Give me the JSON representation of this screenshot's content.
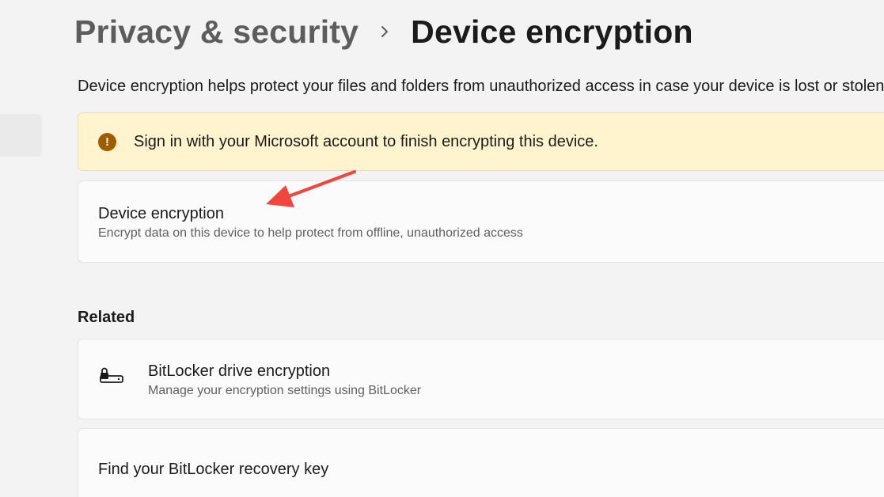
{
  "breadcrumb": {
    "parent": "Privacy & security",
    "separator_icon": "chevron-right-icon",
    "current": "Device encryption"
  },
  "description": "Device encryption helps protect your files and folders from unauthorized access in case your device is lost or stolen.",
  "warning": {
    "icon": "warning-circle-icon",
    "text": "Sign in with your Microsoft account to finish encrypting this device.",
    "background": "#fff4ce",
    "icon_color": "#9d5d00"
  },
  "device_encryption": {
    "title": "Device encryption",
    "subtitle": "Encrypt data on this device to help protect from offline, unauthorized access"
  },
  "related": {
    "heading": "Related",
    "items": [
      {
        "icon": "bitlocker-drive-icon",
        "title": "BitLocker drive encryption",
        "subtitle": "Manage your encryption settings using BitLocker"
      },
      {
        "title": "Find your BitLocker recovery key"
      }
    ]
  },
  "annotation": {
    "icon": "red-arrow-annotation",
    "color": "#f2453d"
  }
}
